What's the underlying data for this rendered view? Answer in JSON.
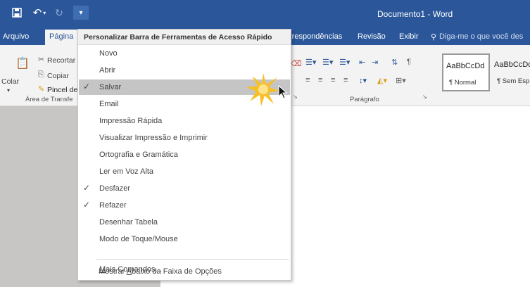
{
  "window": {
    "title": "Documento1  -  Word"
  },
  "qat": {
    "save_icon": "save-icon",
    "undo_icon": "undo-icon",
    "redo_icon": "redo-icon",
    "customize_icon": "customize-qat-icon"
  },
  "tabs": {
    "arquivo": "Arquivo",
    "pagina": "Página",
    "correspondencias": "rrespondências",
    "revisao": "Revisão",
    "exibir": "Exibir",
    "tellme": "Diga-me o que você des"
  },
  "ribbon": {
    "recortar": "Recortar",
    "copiar": "Copiar",
    "colar": "Colar",
    "pincel": "Pincel de",
    "clipboard_group": "Área de Transfe",
    "paragraph_group": "Parágrafo",
    "styles": [
      {
        "sample": "AaBbCcDd",
        "name": "¶ Normal"
      },
      {
        "sample": "AaBbCcDd",
        "name": "¶ Sem Esp."
      }
    ]
  },
  "dropdown": {
    "title": "Personalizar Barra de Ferramentas de Acesso Rápido",
    "items": [
      {
        "label": "Novo",
        "checked": false
      },
      {
        "label": "Abrir",
        "checked": false
      },
      {
        "label": "Salvar",
        "checked": true
      },
      {
        "label": "Email",
        "checked": false
      },
      {
        "label": "Impressão Rápida",
        "checked": false
      },
      {
        "label": "Visualizar Impressão e Imprimir",
        "checked": false
      },
      {
        "label": "Ortografia e Gramática",
        "checked": false
      },
      {
        "label": "Ler em Voz Alta",
        "checked": false
      },
      {
        "label": "Desfazer",
        "checked": true
      },
      {
        "label": "Refazer",
        "checked": true
      },
      {
        "label": "Desenhar Tabela",
        "checked": false
      },
      {
        "label": "Modo de Toque/Mouse",
        "checked": false
      }
    ],
    "more_commands": {
      "prefix": "",
      "accel": "M",
      "rest": "ais Comandos..."
    },
    "show_below": {
      "prefix": "Mostrar ",
      "accel": "A",
      "rest": "baixo da Faixa de Opções"
    }
  },
  "colors": {
    "title_bar": "#2b579a",
    "highlight": "#c5c5c5"
  }
}
